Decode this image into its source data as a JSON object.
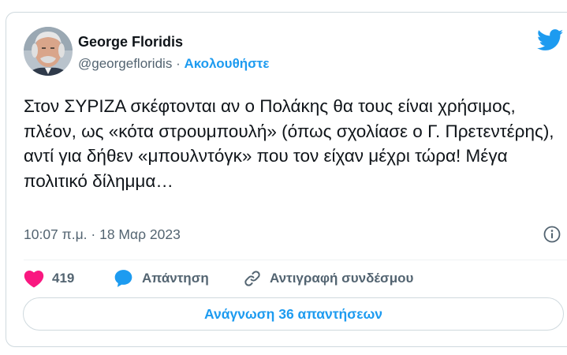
{
  "author": {
    "name": "George Floridis",
    "handle": "@georgefloridis",
    "separator": "·",
    "follow_label": "Ακολουθήστε"
  },
  "tweet": {
    "text": "Στον ΣΥΡΙΖΑ σκέφτονται αν ο Πολάκης θα τους είναι χρήσιμος, πλέον, ως «κότα στρουμπουλή» (όπως σχολίασε ο Γ. Πρετεντέρης), αντί για δήθεν «μπουλντόγκ» που τον είχαν μέχρι τώρα! Μέγα πολιτικό δίλημμα…",
    "timestamp": "10:07 π.μ. · 18 Μαρ 2023"
  },
  "actions": {
    "likes_count": "419",
    "reply_label": "Απάντηση",
    "copy_link_label": "Αντιγραφή συνδέσμου"
  },
  "read_replies_label": "Ανάγνωση 36 απαντήσεων",
  "colors": {
    "accent": "#1d9bf0",
    "like": "#f91880",
    "secondary_text": "#536471"
  },
  "icons": [
    "twitter-bird-icon",
    "info-icon",
    "heart-icon",
    "reply-bubble-icon",
    "link-icon"
  ]
}
